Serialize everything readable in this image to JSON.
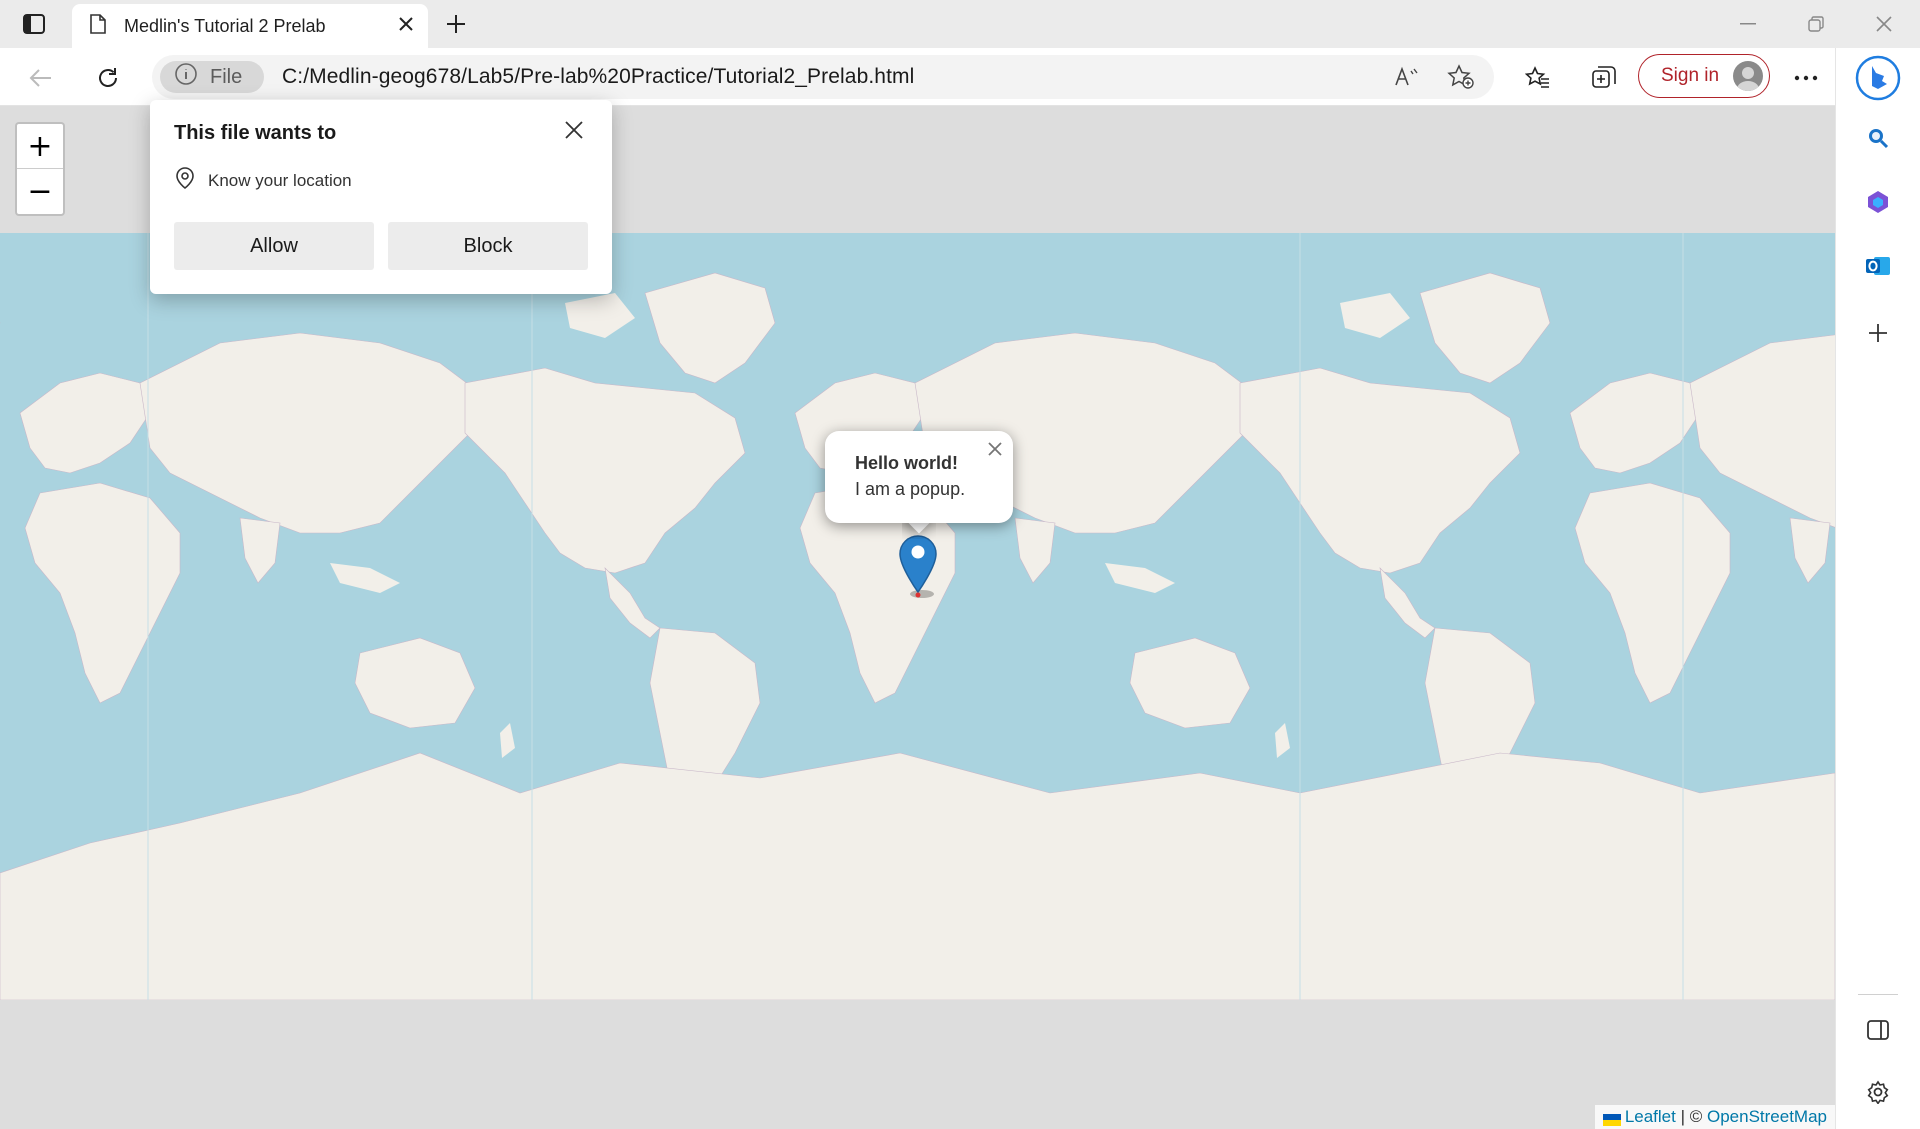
{
  "browser": {
    "tab": {
      "title": "Medlin's Tutorial 2 Prelab"
    },
    "address": {
      "scheme_chip": "File",
      "url": "C:/Medlin-geog678/Lab5/Pre-lab%20Practice/Tutorial2_Prelab.html"
    },
    "signin_label": "Sign in"
  },
  "permission_prompt": {
    "title": "This file wants to",
    "request": "Know your location",
    "allow_label": "Allow",
    "block_label": "Block"
  },
  "map": {
    "zoom_in_label": "+",
    "zoom_out_label": "−",
    "popup": {
      "title": "Hello world!",
      "text": "I am a popup."
    },
    "attribution": {
      "leaflet": "Leaflet",
      "separator": " | © ",
      "osm": "OpenStreetMap"
    },
    "colors": {
      "water": "#aad3df",
      "land": "#f2efe9",
      "marker": "#2a81cb"
    }
  },
  "icons": {
    "tab_actions": "tab-actions-icon",
    "page": "page-icon",
    "close": "close-icon",
    "new_tab": "plus-icon",
    "back": "back-arrow-icon",
    "refresh": "refresh-icon",
    "info": "info-icon",
    "read_aloud": "read-aloud-icon",
    "add_favorite": "add-favorite-icon",
    "favorites": "favorites-icon",
    "collections": "collections-icon",
    "more": "more-icon",
    "bing": "bing-icon",
    "search": "search-icon",
    "office": "office-icon",
    "outlook": "outlook-icon",
    "add": "plus-icon",
    "sidebar": "sidebar-toggle-icon",
    "settings": "gear-icon",
    "location": "location-pin-icon"
  }
}
